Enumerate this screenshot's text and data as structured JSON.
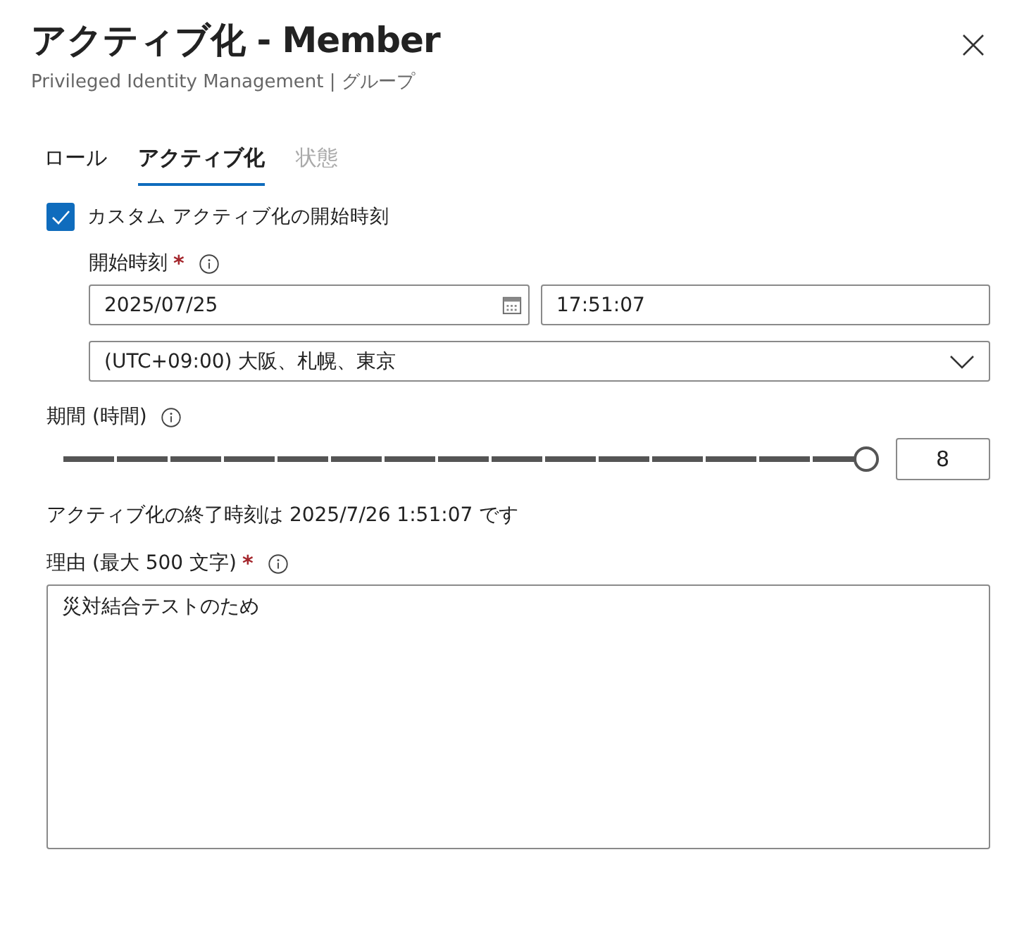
{
  "panel": {
    "title": "アクティブ化 - Member",
    "subtitle": "Privileged Identity Management | グループ"
  },
  "tabs": [
    {
      "label": "ロール",
      "selected": false,
      "disabled": false
    },
    {
      "label": "アクティブ化",
      "selected": true,
      "disabled": false
    },
    {
      "label": "状態",
      "selected": false,
      "disabled": true
    }
  ],
  "custom_start": {
    "label": "カスタム アクティブ化の開始時刻",
    "checked": true
  },
  "start": {
    "label": "開始時刻",
    "required": true,
    "required_mark": "*",
    "date": "2025/07/25",
    "time": "17:51:07",
    "timezone": "(UTC+09:00) 大阪、札幌、東京"
  },
  "duration": {
    "label": "期間 (時間)",
    "level": 1,
    "value": "8"
  },
  "end_note": "アクティブ化の終了時刻は 2025/7/26 1:51:07 です",
  "reason": {
    "label": "理由 (最大 500 文字)",
    "required": true,
    "required_mark": "*",
    "value": "災対結合テストのため"
  }
}
